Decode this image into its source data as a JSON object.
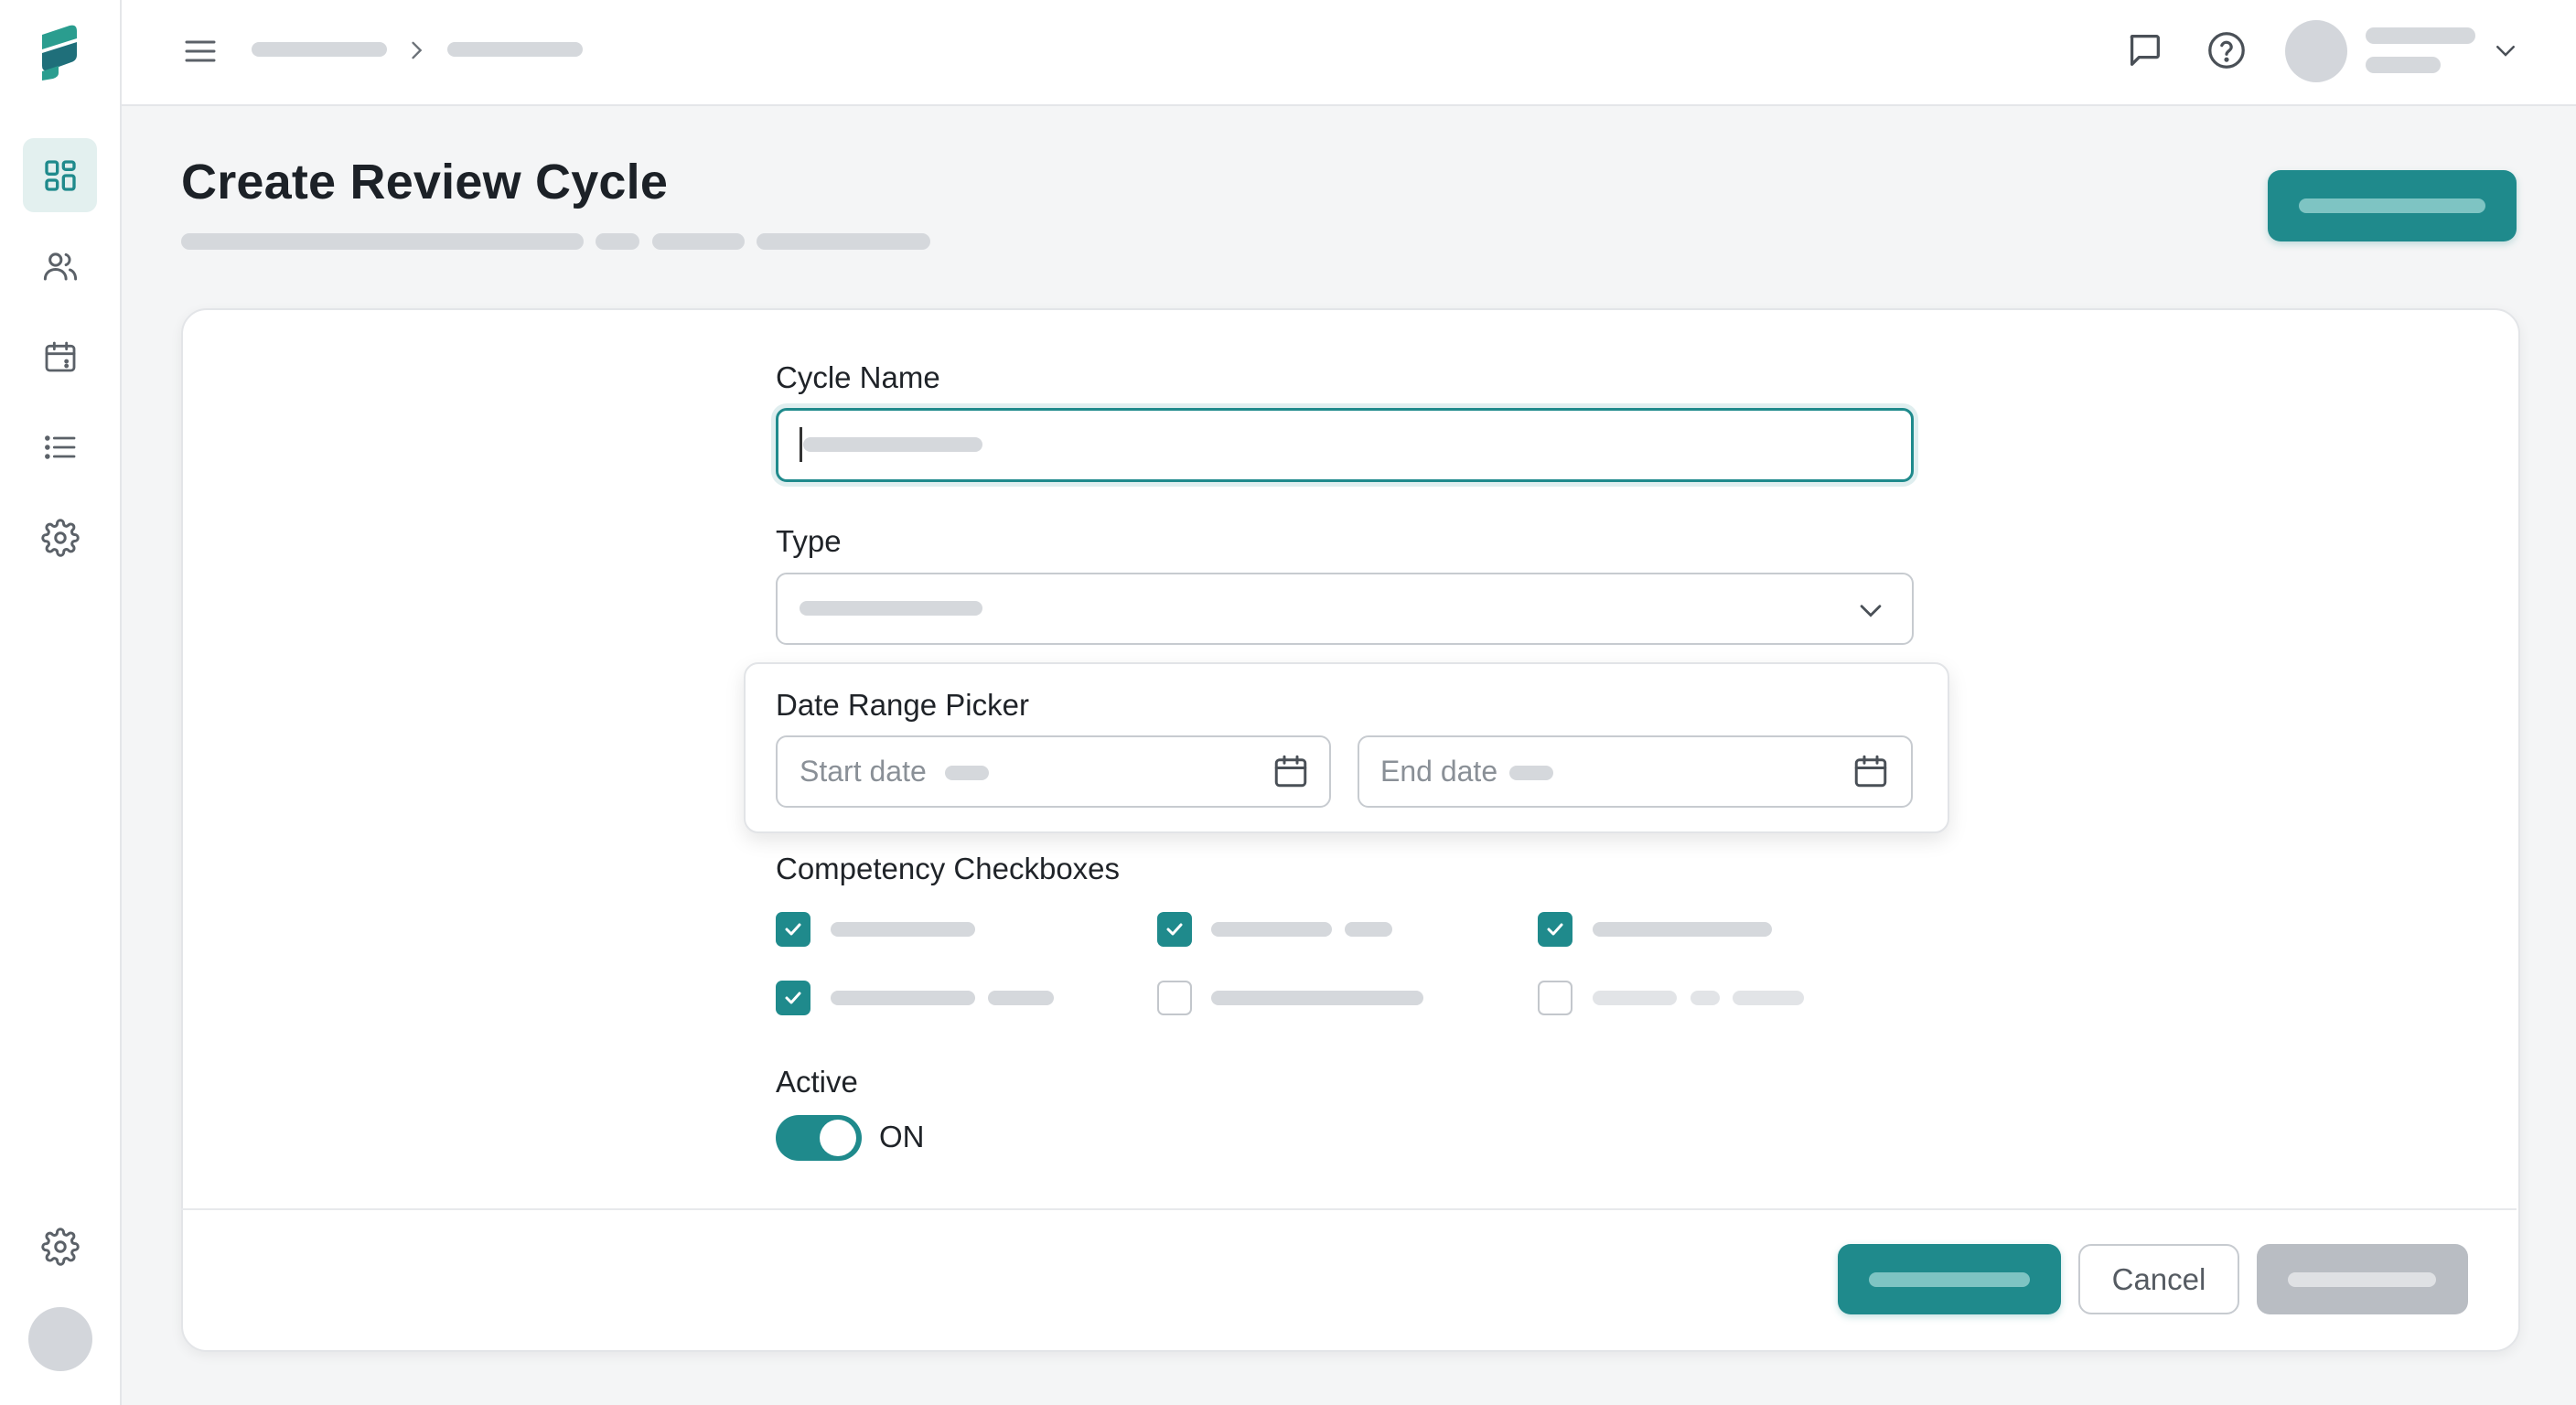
{
  "page": {
    "title": "Create Review Cycle"
  },
  "form": {
    "cycle_name": {
      "label": "Cycle Name",
      "value": ""
    },
    "type": {
      "label": "Type"
    },
    "date_range": {
      "label": "Date Range Picker",
      "start_placeholder": "Start date",
      "end_placeholder": "End date"
    },
    "competencies": {
      "label": "Competency Checkboxes",
      "items": [
        {
          "checked": true
        },
        {
          "checked": true
        },
        {
          "checked": true
        },
        {
          "checked": true
        },
        {
          "checked": false
        },
        {
          "checked": false
        }
      ]
    },
    "active": {
      "label": "Active",
      "state_text": "ON",
      "on": true
    }
  },
  "footer": {
    "cancel_label": "Cancel"
  },
  "theme": {
    "accent": "#1f8a8c",
    "placeholder_bar": "#d5d8dc",
    "disabled": "#b9bdc3"
  },
  "icons": {
    "sidebar": [
      "dashboard-icon",
      "people-icon",
      "calendar-icon",
      "list-icon",
      "settings-icon",
      "settings-icon"
    ],
    "topbar": [
      "menu-icon",
      "chevron-right-icon",
      "message-icon",
      "help-icon",
      "chevron-down-icon"
    ]
  }
}
